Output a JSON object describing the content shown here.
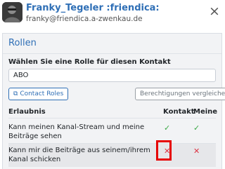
{
  "header": {
    "title": "Franky_Tegeler :friendica:",
    "subtitle": "franky@friendica.a-zwenkau.de",
    "close_icon": "close-icon"
  },
  "panel": {
    "title": "Rollen",
    "role_label": "Wählen Sie eine Rolle für diesen Kontakt",
    "role_value": "ABO",
    "contact_roles_label": "Contact Roles",
    "compare_label": "Berechtigungen vergleichen"
  },
  "table": {
    "headers": {
      "permission": "Erlaubnis",
      "contact": "Kontakt",
      "mine": "Meine"
    },
    "rows": [
      {
        "text": "Kann meinen Kanal-Stream und meine Beiträge sehen",
        "contact": "✓",
        "mine": "✓"
      },
      {
        "text": "Kann mir die Beiträge aus seinem/ihrem Kanal schicken",
        "contact": "✕",
        "mine": "✕"
      }
    ]
  },
  "colors": {
    "accent": "#2f6fb6",
    "check": "#3aa845",
    "cross": "#dc3545",
    "highlight": "#e60000"
  }
}
